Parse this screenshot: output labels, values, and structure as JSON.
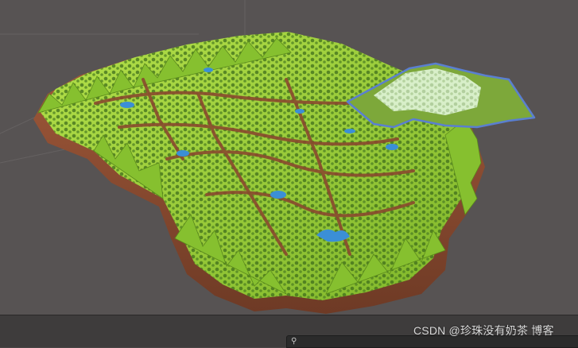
{
  "scene": {
    "colors": {
      "background": "#575353",
      "grid": "#6a6666",
      "grass": "#9bd13a",
      "grass_dark": "#5f8f1f",
      "dirt": "#a0583a",
      "dirt_dark": "#7a3f28",
      "water": "#3b8fd6",
      "tree": "#3e6b1a",
      "selection_outline": "#5a7fd0",
      "selection_fill": "#d8f4d0"
    },
    "description_icons": [
      "terrain-mesh",
      "tree-prop",
      "lake-water",
      "selected-region-highlight"
    ]
  },
  "toolbar": {
    "search_icon": "search-icon"
  },
  "watermark": {
    "text": "CSDN @珍珠没有奶茶 博客"
  }
}
